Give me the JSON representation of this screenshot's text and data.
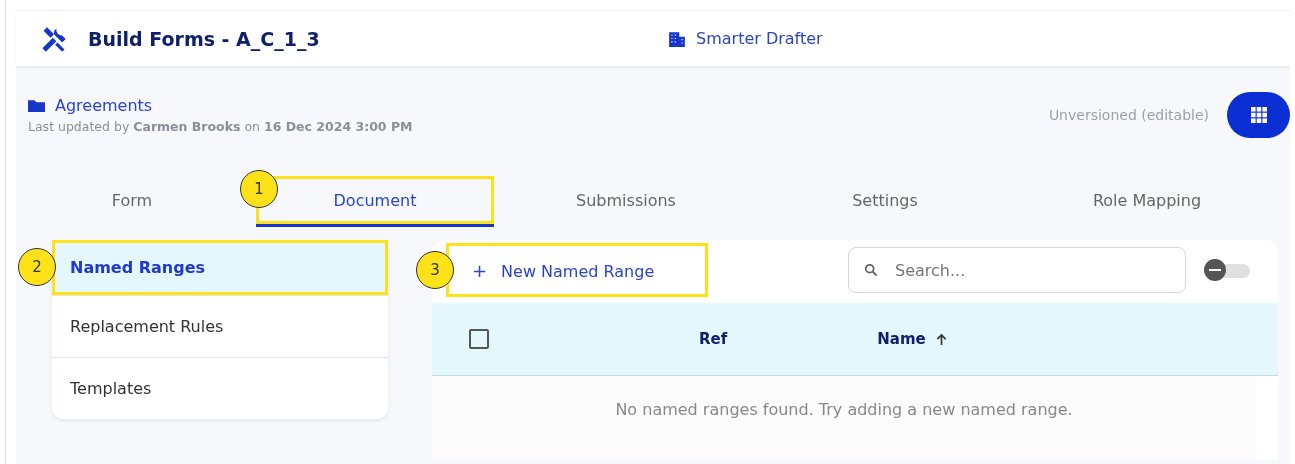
{
  "header": {
    "title": "Build Forms - A_C_1_3",
    "workspace": "Smarter Drafter"
  },
  "info": {
    "folder": "Agreements",
    "updated": "Last updated by **Carmen Brooks** on **16 Dec 2024 3:00 PM**",
    "version": "Unversioned (editable)"
  },
  "tabs": [
    {
      "label": "Form",
      "selected": false
    },
    {
      "label": "Document",
      "selected": true,
      "callout": "1"
    },
    {
      "label": "Submissions",
      "selected": false
    },
    {
      "label": "Settings",
      "selected": false
    },
    {
      "label": "Role Mapping",
      "selected": false
    }
  ],
  "sidebar": {
    "items": [
      {
        "label": "Named Ranges",
        "selected": true,
        "callout": "2"
      },
      {
        "label": "Replacement Rules",
        "selected": false
      },
      {
        "label": "Templates",
        "selected": false
      }
    ]
  },
  "toolbar": {
    "new_button": {
      "label": "+",
      "text": "New Named Range",
      "callout": "3"
    },
    "search": {
      "placeholder": "Search..."
    },
    "toggle": {
      "on": false
    }
  },
  "table": {
    "select_all": {
      "checked": false
    },
    "columns": [
      {
        "label": "Ref",
        "sorted": false
      },
      {
        "label": "Name",
        "sorted": true
      }
    ],
    "empty_message": "No named ranges found. Try adding a new named range."
  }
}
